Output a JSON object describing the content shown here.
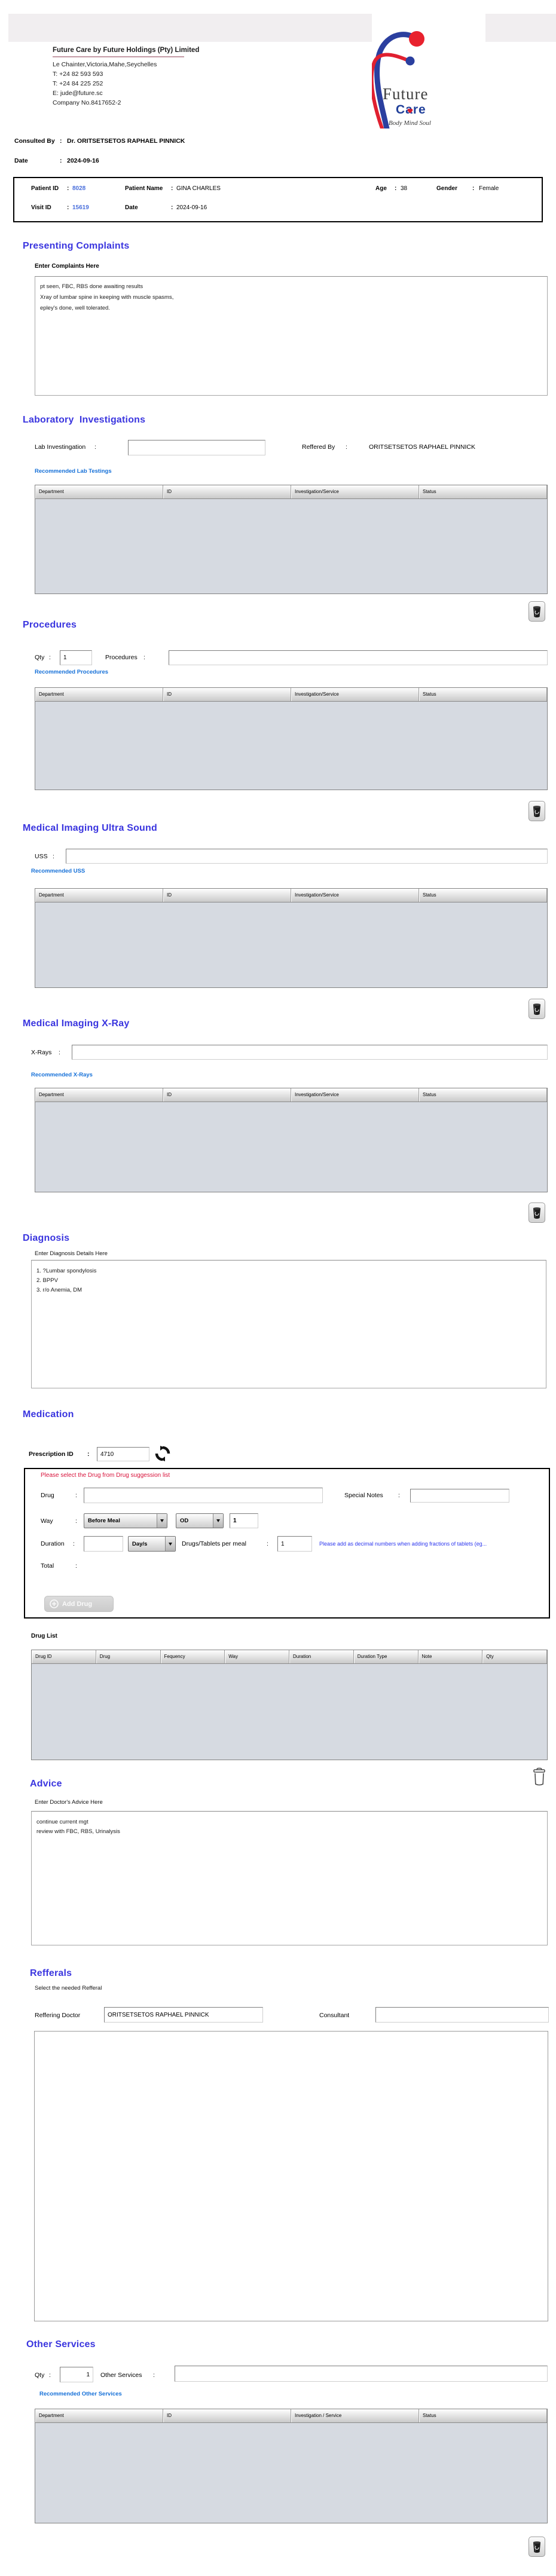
{
  "ui": {
    "colon": ":"
  },
  "letterhead": {
    "company": "Future Care by Future Holdings (Pty) Limited",
    "line1": "Le Chainter,Victoria,Mahe,Seychelles",
    "line2": "T: +24  82 593 593",
    "line3": "T: +24  84 225 252",
    "line4": "E: jude@future.sc",
    "line5": "Company No.8417652-2",
    "logo_word1": "Future",
    "logo_word2": "Care",
    "logo_tagline": "Body Mind Soul"
  },
  "consult": {
    "consulted_by_label": "Consulted By",
    "consulted_by_value": "Dr.  ORITSETSETOS RAPHAEL PINNICK",
    "date_label": "Date",
    "date_value": "2024-09-16"
  },
  "patient": {
    "id_label": "Patient ID",
    "id": "8028",
    "name_label": "Patient Name",
    "name": "GINA CHARLES",
    "age_label": "Age",
    "age": "38",
    "gender_label": "Gender",
    "gender": "Female",
    "visit_label": "Visit ID",
    "visit_id": "15619",
    "date_label": "Date",
    "date": "2024-09-16"
  },
  "complaints": {
    "title": "Presenting Complaints",
    "label": "Enter Complaints Here",
    "text": "pt seen, FBC, RBS done awaiting results\nXray of lumbar spine in keeping with muscle spasms,\nepley's done, well tolerated."
  },
  "lab": {
    "title": "Laboratory  Investigations",
    "input_label": "Lab Investingation",
    "referred_label": "Reffered By",
    "referred_value": "ORITSETSETOS RAPHAEL PINNICK",
    "recommended": "Recommended Lab Testings",
    "headers": [
      "Department",
      "ID",
      "Investigation/Service",
      "Status"
    ]
  },
  "procedures": {
    "title": "Procedures",
    "qty_label": "Qty",
    "qty": "1",
    "input_label": "Procedures",
    "recommended": "Recommended Procedures",
    "headers": [
      "Department",
      "ID",
      "Investigation/Service",
      "Status"
    ]
  },
  "uss": {
    "title": "Medical Imaging Ultra Sound",
    "input_label": "USS",
    "recommended": "Recommended USS",
    "headers": [
      "Department",
      "ID",
      "Investigation/Service",
      "Status"
    ]
  },
  "xray": {
    "title": "Medical Imaging X-Ray",
    "input_label": "X-Rays",
    "recommended": "Recommended X-Rays",
    "headers": [
      "Department",
      "ID",
      "Investigation/Service",
      "Status"
    ]
  },
  "diagnosis": {
    "title": "Diagnosis",
    "label": "Enter Diagnosis Details Here",
    "text": "1. ?Lumbar spondylosis\n2. BPPV\n3. r/o Anemia, DM"
  },
  "medication": {
    "title": "Medication",
    "rx_label": "Prescription ID",
    "rx_id": "4710",
    "warning": "Please select the Drug from Drug suggession list",
    "drug_label": "Drug",
    "special_label": "Special Notes",
    "way_label": "Way",
    "meal_option": "Before Meal",
    "freq_option": "OD",
    "way_qty": "1",
    "duration_label": "Duration",
    "duration_unit": "Day/s",
    "per_meal_label": "Drugs/Tablets per meal",
    "per_meal_qty": "1",
    "hint": "Please add as decimal numbers when adding fractions of tablets (eg...",
    "total_label": "Total",
    "add_btn": "Add Drug",
    "list_label": "Drug List",
    "headers": [
      "Drug ID",
      "Drug",
      "Fequency",
      "Way",
      "Duration",
      "Duration Type",
      "Note",
      "Qty"
    ]
  },
  "advice": {
    "title": "Advice",
    "label": "Enter Doctor's Advice Here",
    "text": "continue current mgt\nreview with FBC, RBS, Urinalysis"
  },
  "referrals": {
    "title": "Refferals",
    "subtitle": "Select the needed Refferal",
    "doctor_label": "Reffering Doctor",
    "doctor": "ORITSETSETOS RAPHAEL PINNICK",
    "consultant_label": "Consultant"
  },
  "other": {
    "title": "Other Services",
    "qty_label": "Qty",
    "qty": "1",
    "input_label": "Other Services",
    "recommended": "Recommended Other Services",
    "headers": [
      "Department",
      "ID",
      "Investigation / Service",
      "Status"
    ]
  },
  "colors": {
    "heading": "#3a35df",
    "link": "#1570d8",
    "warning_red": "#d8143c",
    "hint_blue": "#2b35ee",
    "id_blue": "#4a6fdc",
    "table_body": "#d6dae1"
  }
}
